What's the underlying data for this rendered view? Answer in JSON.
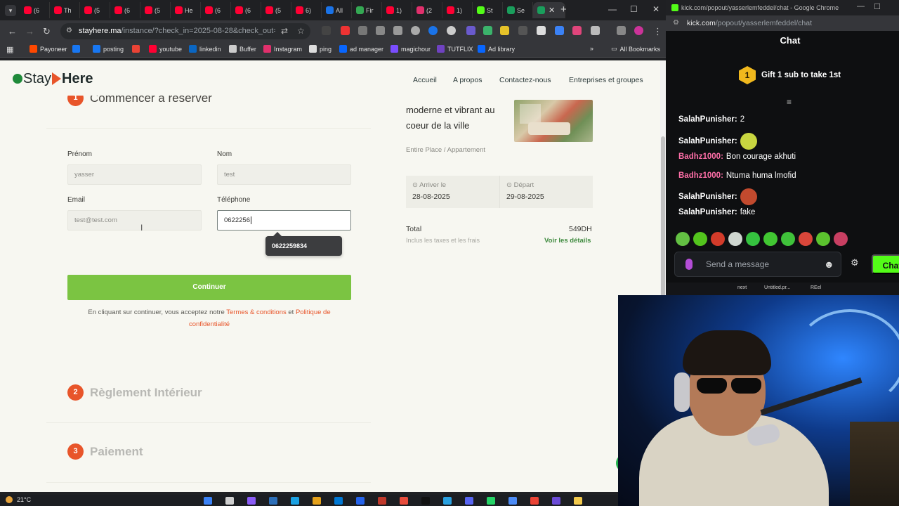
{
  "browser_left": {
    "tabs": [
      {
        "label": "(6",
        "color": "#ff0033"
      },
      {
        "label": "Th",
        "color": "#ff0033"
      },
      {
        "label": "(5",
        "color": "#ff0033"
      },
      {
        "label": "(6",
        "color": "#ff0033"
      },
      {
        "label": "(5",
        "color": "#ff0033"
      },
      {
        "label": "He",
        "color": "#ff0033"
      },
      {
        "label": "(6",
        "color": "#ff0033"
      },
      {
        "label": "(6",
        "color": "#ff0033"
      },
      {
        "label": "(5",
        "color": "#ff0033"
      },
      {
        "label": "6)",
        "color": "#ff0033"
      },
      {
        "label": "All",
        "color": "#1a73e8"
      },
      {
        "label": "Fir",
        "color": "#34a853"
      },
      {
        "label": "1)",
        "color": "#ff0033"
      },
      {
        "label": "(2",
        "color": "#e1306c"
      },
      {
        "label": "1)",
        "color": "#ff0033"
      },
      {
        "label": "St",
        "color": "#53fc18"
      },
      {
        "label": "Se",
        "color": "#1a9e5c"
      }
    ],
    "active_tab_index": 17,
    "url_host": "stayhere.ma",
    "url_path": "/instance/?check_in=2025-08-28&check_out=202...",
    "bookmarks": [
      {
        "label": "Payoneer",
        "color": "#ff4800"
      },
      {
        "label": "",
        "color": "#1877f2"
      },
      {
        "label": "posting",
        "color": "#1877f2"
      },
      {
        "label": "",
        "color": "#ea4335"
      },
      {
        "label": "youtube",
        "color": "#ff0033"
      },
      {
        "label": "linkedin",
        "color": "#0a66c2"
      },
      {
        "label": "Buffer",
        "color": "#cccccc"
      },
      {
        "label": "Instagram",
        "color": "#e1306c"
      },
      {
        "label": "ping",
        "color": "#dddddd"
      },
      {
        "label": "ad manager",
        "color": "#0866ff"
      },
      {
        "label": "magichour",
        "color": "#7a4dff"
      },
      {
        "label": "TUTFLIX",
        "color": "#6f42c1"
      },
      {
        "label": "Ad library",
        "color": "#0866ff"
      }
    ],
    "all_bookmarks": "All Bookmarks"
  },
  "site": {
    "logo_stay": "Stay",
    "logo_here": "Here",
    "nav": [
      "Accueil",
      "A propos",
      "Contactez-nous",
      "Entreprises et groupes"
    ],
    "step1_title": "Commencer à réserver",
    "form": {
      "prenom_label": "Prénom",
      "prenom_value": "yasser",
      "nom_label": "Nom",
      "nom_value": "test",
      "email_label": "Email",
      "email_value": "test@test.com",
      "phone_label": "Téléphone",
      "phone_value": "0622256",
      "autofill_suggestion": "0622259834"
    },
    "continue_label": "Continuer",
    "terms_prefix": "En cliquant sur continuer, vous acceptez notre ",
    "terms_link1": "Termes & conditions",
    "terms_mid": " et ",
    "terms_link2": "Politique de confidentialité",
    "step2_num": "2",
    "step2_title": "Règlement Intérieur",
    "step3_num": "3",
    "step3_title": "Paiement",
    "summary": {
      "title": "moderne et vibrant au coeur de la ville",
      "type": "Entire Place / Appartement",
      "arrive_label": "Arriver le",
      "arrive_value": "28-08-2025",
      "depart_label": "Départ",
      "depart_value": "29-08-2025",
      "total_label": "Total",
      "total_value": "549DH",
      "total_sub": "Inclus les taxes et les frais",
      "details_link": "Voir les détails"
    },
    "accent_orange": "#e8552a",
    "accent_green": "#7bc442"
  },
  "taskbar": {
    "temperature": "21°C"
  },
  "chat_window": {
    "title": "kick.com/popout/yasserlemfeddel/chat - Google Chrome",
    "url_host": "kick.com",
    "url_path": "/popout/yasserlemfeddel/chat",
    "header": "Chat",
    "gift_count": "1",
    "gift_text": "Gift 1 sub to take 1st",
    "messages": [
      {
        "user": "SalahPunisher:",
        "text": "2",
        "color": "#ffffff",
        "emote": false
      },
      {
        "user": "SalahPunisher:",
        "text": "",
        "color": "#ffffff",
        "emote": true,
        "emote_color": "#c8d640"
      },
      {
        "user": "Badhz1000:",
        "text": "Bon courage akhuti",
        "color": "#ff6fa8",
        "emote": false
      },
      {
        "user": "Badhz1000:",
        "text": "Ntuma huma lmofid",
        "color": "#ff6fa8",
        "emote": false
      },
      {
        "user": "SalahPunisher:",
        "text": "",
        "color": "#ffffff",
        "emote": true,
        "emote_color": "#c24a2e"
      },
      {
        "user": "SalahPunisher:",
        "text": "fake",
        "color": "#ffffff",
        "emote": false
      }
    ],
    "emote_colors": [
      "#63c043",
      "#53c41d",
      "#d23b2a",
      "#cfd6d0",
      "#35c23f",
      "#41c632",
      "#3fc13a",
      "#d9463a",
      "#5bc22e",
      "#c83f62"
    ],
    "input_placeholder": "Send a message",
    "send_label": "Chat",
    "bottom_items": [
      "next",
      "Untitled.pr...",
      "REel"
    ]
  }
}
